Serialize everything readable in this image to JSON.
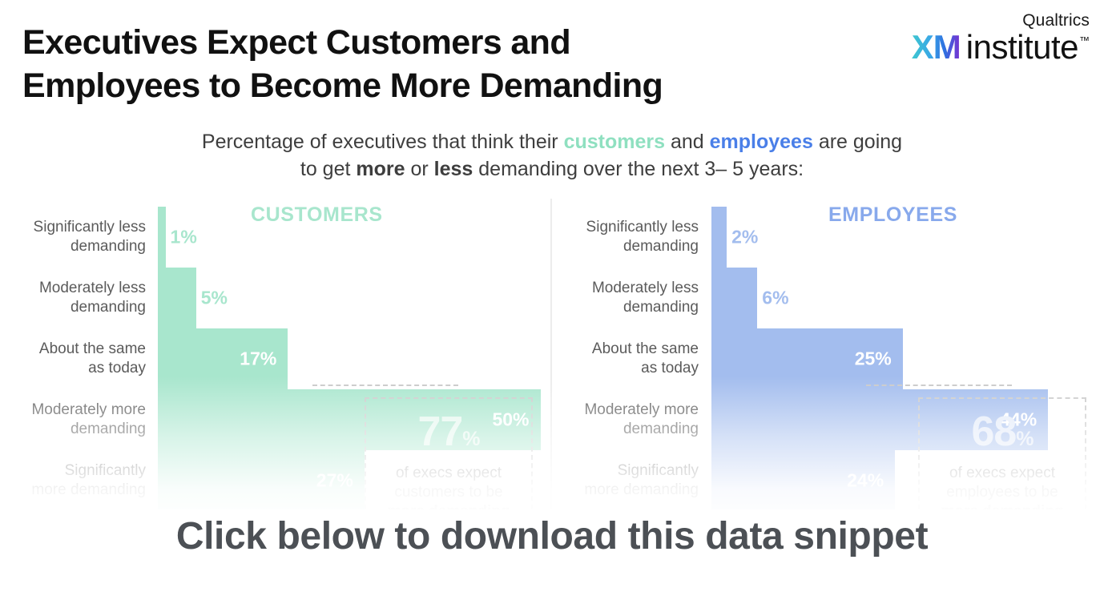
{
  "title": {
    "line1": "Executives Expect Customers and",
    "line2": "Employees to Become More Demanding"
  },
  "logo": {
    "brand": "Qualtrics",
    "xm": "XM",
    "institute": "institute",
    "tm": "™"
  },
  "subtitle": {
    "part1": "Percentage of executives that think their ",
    "customers": "customers",
    "part2": " and ",
    "employees": "employees",
    "part3": " are going",
    "part4": "to get ",
    "more": "more",
    "part5": " or ",
    "less": "less",
    "part6": " demanding over the next 3– 5 years:"
  },
  "banner": {
    "text": "Click below to download this data snippet"
  },
  "colors": {
    "customers_accent": "#a8e6cd",
    "employees_accent": "#a3bdee",
    "title": "#111111",
    "label": "#5b5b5b",
    "banner": "#4c5055",
    "divider": "#ececec",
    "callout_border": "#c9c9c9"
  },
  "chart_data": [
    {
      "type": "bar",
      "title": "CUSTOMERS",
      "orientation": "horizontal",
      "xlabel": "",
      "ylabel": "",
      "xlim": [
        0,
        60
      ],
      "grid": false,
      "legend": "none",
      "accent": "#a8e6cd",
      "categories": [
        "Significantly less\ndemanding",
        "Moderately less\ndemanding",
        "About the same\nas today",
        "Moderately more\ndemanding",
        "Significantly\nmore demanding"
      ],
      "values": [
        1,
        5,
        17,
        50,
        27
      ],
      "value_labels": [
        "1%",
        "5%",
        "17%",
        "50%",
        "27%"
      ],
      "label_placement": [
        "outside",
        "outside",
        "inside",
        "inside",
        "inside"
      ],
      "annotation": {
        "value": "77",
        "pct": "%",
        "caption_line1": "of execs expect",
        "caption_line2": "customers to be",
        "caption_line3": "more demanding"
      }
    },
    {
      "type": "bar",
      "title": "EMPLOYEES",
      "orientation": "horizontal",
      "xlabel": "",
      "ylabel": "",
      "xlim": [
        0,
        60
      ],
      "grid": false,
      "legend": "none",
      "accent": "#a3bdee",
      "categories": [
        "Significantly less\ndemanding",
        "Moderately less\ndemanding",
        "About the same\nas today",
        "Moderately more\ndemanding",
        "Significantly\nmore demanding"
      ],
      "values": [
        2,
        6,
        25,
        44,
        24
      ],
      "value_labels": [
        "2%",
        "6%",
        "25%",
        "44%",
        "24%"
      ],
      "label_placement": [
        "outside",
        "outside",
        "inside",
        "inside",
        "inside"
      ],
      "annotation": {
        "value": "68",
        "pct": "%",
        "caption_line1": "of execs expect",
        "caption_line2": "employees to be",
        "caption_line3": "more demanding"
      }
    }
  ]
}
